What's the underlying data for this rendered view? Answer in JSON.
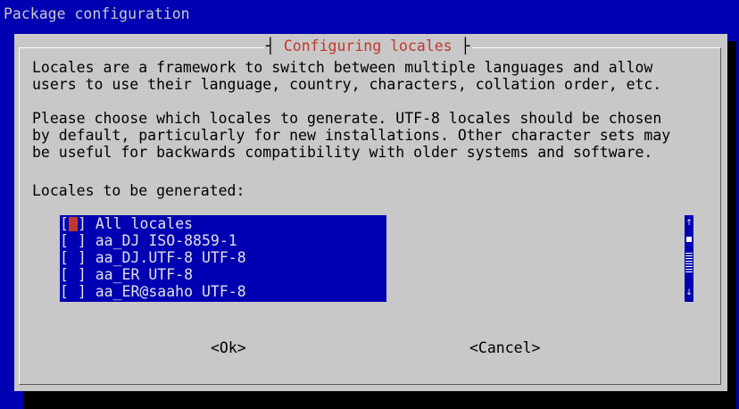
{
  "backtitle": "Package configuration",
  "dialog": {
    "title": "Configuring locales",
    "description": [
      "Locales are a framework to switch between multiple languages and allow",
      "users to use their language, country, characters, collation order, etc."
    ],
    "instructions": [
      "Please choose which locales to generate. UTF-8 locales should be chosen",
      "by default, particularly for new installations. Other character sets may",
      "be useful for backwards compatibility with older systems and software."
    ],
    "list_label": "Locales to be generated:",
    "items": [
      {
        "check": "[ ]",
        "label": "All locales",
        "focused": true,
        "checked": false
      },
      {
        "check": "[ ]",
        "label": "aa_DJ ISO-8859-1",
        "focused": false,
        "checked": false
      },
      {
        "check": "[ ]",
        "label": "aa_DJ.UTF-8 UTF-8",
        "focused": false,
        "checked": false
      },
      {
        "check": "[ ]",
        "label": "aa_ER UTF-8",
        "focused": false,
        "checked": false
      },
      {
        "check": "[ ]",
        "label": "aa_ER@saaho UTF-8",
        "focused": false,
        "checked": false
      }
    ],
    "scrollbar": {
      "up_icon": "arrow-up-icon",
      "down_icon": "arrow-down-icon"
    },
    "buttons": {
      "ok": "<Ok>",
      "cancel": "<Cancel>"
    }
  },
  "colors": {
    "background": "#0000b2",
    "dialog": "#c8c8c8",
    "title": "#c0392b",
    "list_bg": "#0000b2",
    "list_text": "#e0e0e0",
    "cursor": "#c0392b",
    "shadow": "#000000"
  }
}
